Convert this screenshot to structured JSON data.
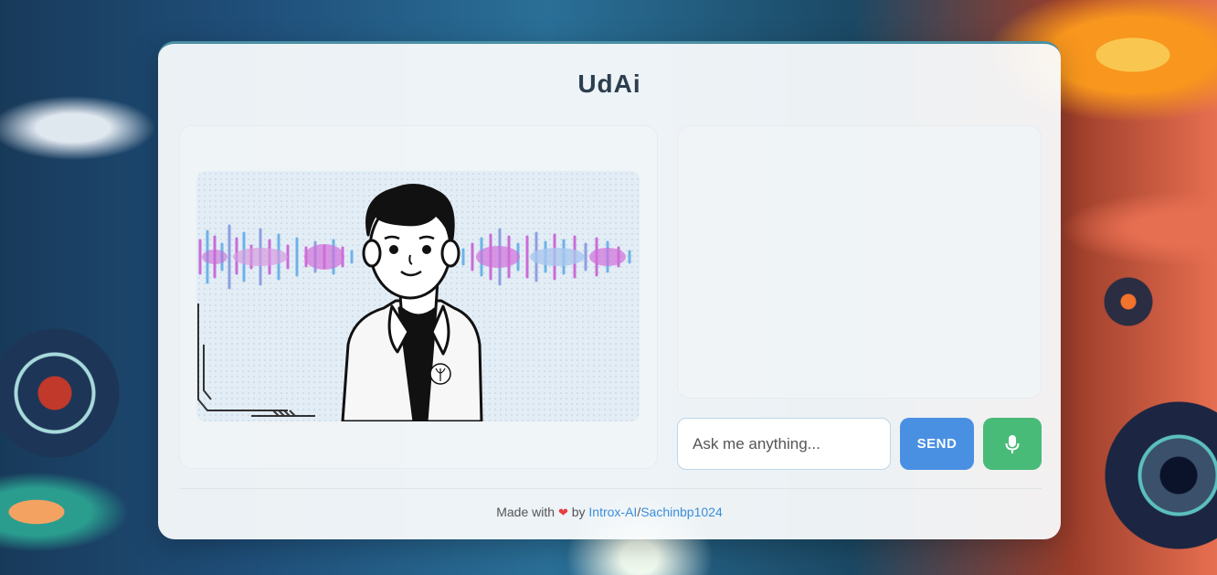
{
  "app": {
    "title": "UdAi"
  },
  "chat": {
    "placeholder": "Ask me anything...",
    "send_label": "SEND"
  },
  "footer": {
    "made_with": "Made with",
    "heart": "❤",
    "by": "by",
    "link1": "Introx-AI",
    "separator": "/",
    "link2": "Sachinbp1024"
  },
  "icons": {
    "mic": "microphone-icon",
    "heart": "heart-icon"
  },
  "colors": {
    "send": "#4a90e2",
    "mic": "#48bb78",
    "title": "#2c3e50",
    "link": "#3b8ed8"
  }
}
